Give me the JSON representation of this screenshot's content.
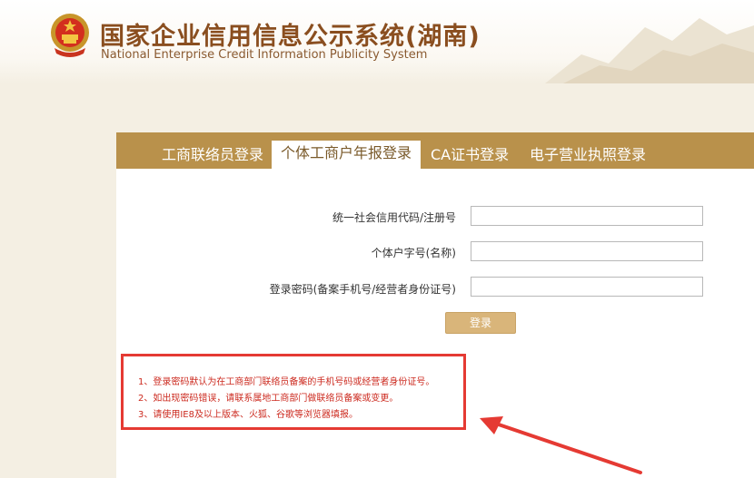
{
  "header": {
    "title_cn": "国家企业信用信息公示系统(湖南)",
    "title_en": "National Enterprise Credit Information Publicity System",
    "emblem_icon": "national-emblem-icon"
  },
  "tabs": [
    {
      "label": "工商联络员登录",
      "active": false
    },
    {
      "label": "个体工商户年报登录",
      "active": true
    },
    {
      "label": "CA证书登录",
      "active": false
    },
    {
      "label": "电子营业执照登录",
      "active": false
    }
  ],
  "form": {
    "code_label": "统一社会信用代码/注册号",
    "name_label": "个体户字号(名称)",
    "password_label": "登录密码(备案手机号/经营者身份证号)",
    "code_value": "",
    "name_value": "",
    "password_value": "",
    "login_label": "登录"
  },
  "notes": [
    "1、登录密码默认为在工商部门联络员备案的手机号码或经营者身份证号。",
    "2、如出现密码错误，请联系属地工商部门做联络员备案或变更。",
    "3、请使用IE8及以上版本、火狐、谷歌等浏览器填报。"
  ],
  "colors": {
    "brand_brown": "#8a4e1f",
    "tab_bar": "#b9914b",
    "button": "#d9b57a",
    "annotation_red": "#e53a33"
  }
}
